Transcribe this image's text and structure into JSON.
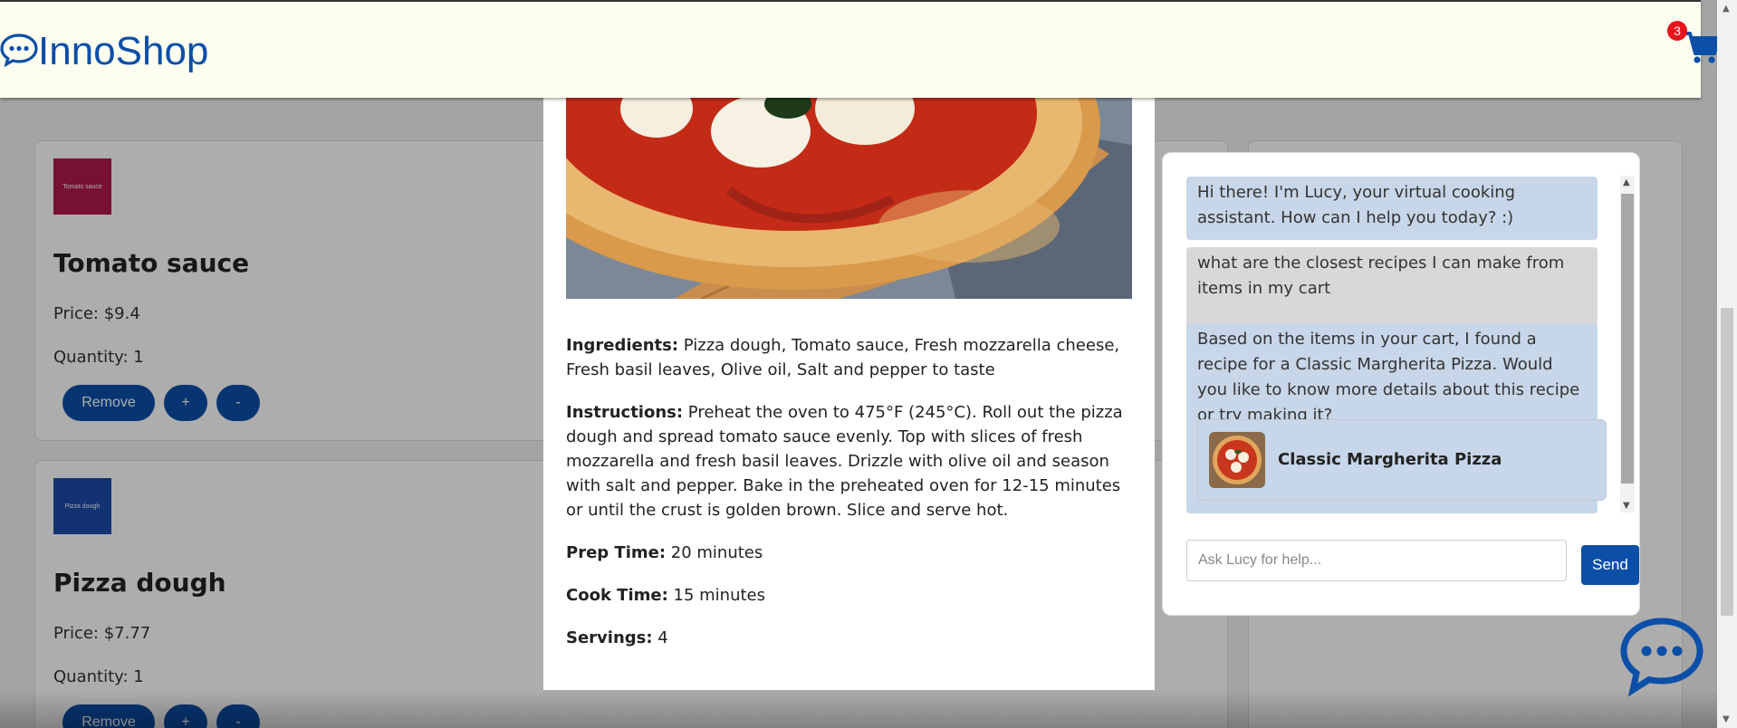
{
  "header": {
    "logo_text": "InnoShop",
    "cart_count": "3"
  },
  "cart_items": [
    {
      "thumb_label": "Tomato sauce",
      "name": "Tomato sauce",
      "price": "Price: $9.4",
      "quantity": "Quantity: 1"
    },
    {
      "thumb_label": "Pizza dough",
      "name": "Pizza dough",
      "price": "Price: $7.77",
      "quantity": "Quantity: 1"
    }
  ],
  "item_buttons": {
    "remove": "Remove",
    "plus": "+",
    "minus": "-"
  },
  "recipe_modal": {
    "ingredients_label": "Ingredients:",
    "ingredients": " Pizza dough, Tomato sauce, Fresh mozzarella cheese, Fresh basil leaves, Olive oil, Salt and pepper to taste",
    "instructions_label": "Instructions:",
    "instructions": " Preheat the oven to 475°F (245°C). Roll out the pizza dough and spread tomato sauce evenly. Top with slices of fresh mozzarella and fresh basil leaves. Drizzle with olive oil and season with salt and pepper. Bake in the preheated oven for 12-15 minutes or until the crust is golden brown. Slice and serve hot.",
    "prep_label": "Prep Time:",
    "prep": " 20 minutes",
    "cook_label": "Cook Time:",
    "cook": " 15 minutes",
    "servings_label": "Servings:",
    "servings": " 4"
  },
  "chat": {
    "messages": [
      {
        "role": "bot",
        "text": "Hi there! I'm Lucy, your virtual cooking assistant. How can I help you today? :)"
      },
      {
        "role": "user",
        "text": "what are the closest recipes I can make from items in my cart"
      },
      {
        "role": "bot",
        "text": "Based on the items in your cart, I found a recipe for a Classic Margherita Pizza. Would you like to know more details about this recipe or try making it?"
      }
    ],
    "recipe_card_name": "Classic Margherita Pizza",
    "input_placeholder": "Ask Lucy for help...",
    "send_label": "Send"
  },
  "colors": {
    "brand": "#0b4fa8",
    "badge": "#e8141b",
    "bot_bubble": "#c7d6e8",
    "user_bubble": "#d8d8d8",
    "header_bg": "#fefef0"
  },
  "icons": [
    "chat-logo-icon",
    "cart-icon",
    "chat-bubble-icon"
  ]
}
